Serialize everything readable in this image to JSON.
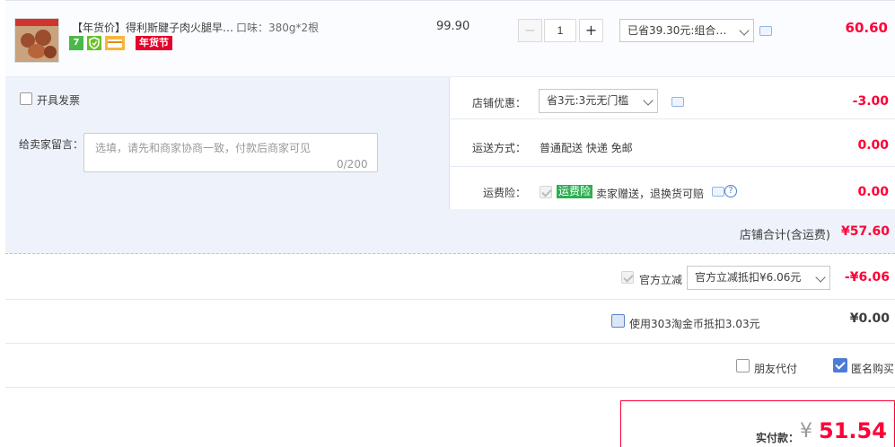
{
  "item": {
    "title": "【年货价】得利斯腱子肉火腿早…",
    "spec": "口味：380g*2根",
    "badge_festival": "年货节",
    "icon_seven": "7",
    "unit_price": "99.90",
    "quantity": "1",
    "qty_minus": "−",
    "qty_plus": "+",
    "promo_select": "已省39.30元:组合…",
    "subtotal": "60.60",
    "icons": [
      "seven-day-return-icon",
      "guarantee-icon",
      "card-icon",
      "message-icon"
    ]
  },
  "invoice": {
    "label": "开具发票",
    "checked": false
  },
  "memo": {
    "label": "给卖家留言：",
    "placeholder": "选填，请先和商家协商一致，付款后商家可见",
    "count": "0/200"
  },
  "shop_discount": {
    "label": "店铺优惠：",
    "select": "省3元:3元无门槛",
    "amount": "-3.00"
  },
  "shipping": {
    "label": "运送方式：",
    "value": "普通配送 快递 免邮",
    "amount": "0.00"
  },
  "insurance": {
    "label": "运费险：",
    "badge": "运费险",
    "text": "卖家赠送，退换货可赔",
    "amount": "0.00"
  },
  "shop_total": {
    "label": "店铺合计(含运费)",
    "value": "¥57.60"
  },
  "official_discount": {
    "label": "官方立减",
    "select": "官方立减抵扣¥6.06元",
    "amount": "-¥6.06"
  },
  "coins": {
    "label": "使用303淘金币抵扣3.03元",
    "amount": "¥0.00",
    "checked": false
  },
  "options": {
    "friend_pay": "朋友代付",
    "friend_pay_checked": false,
    "anonymous": "匿名购买",
    "anonymous_checked": true
  },
  "payment": {
    "label": "实付款：",
    "currency": "¥",
    "value": "51.54"
  },
  "colors": {
    "accent_red": "#ff0036",
    "panel_blue": "#eef3fb",
    "check_blue": "#4d7bd8",
    "insurance_green": "#2fae53"
  }
}
